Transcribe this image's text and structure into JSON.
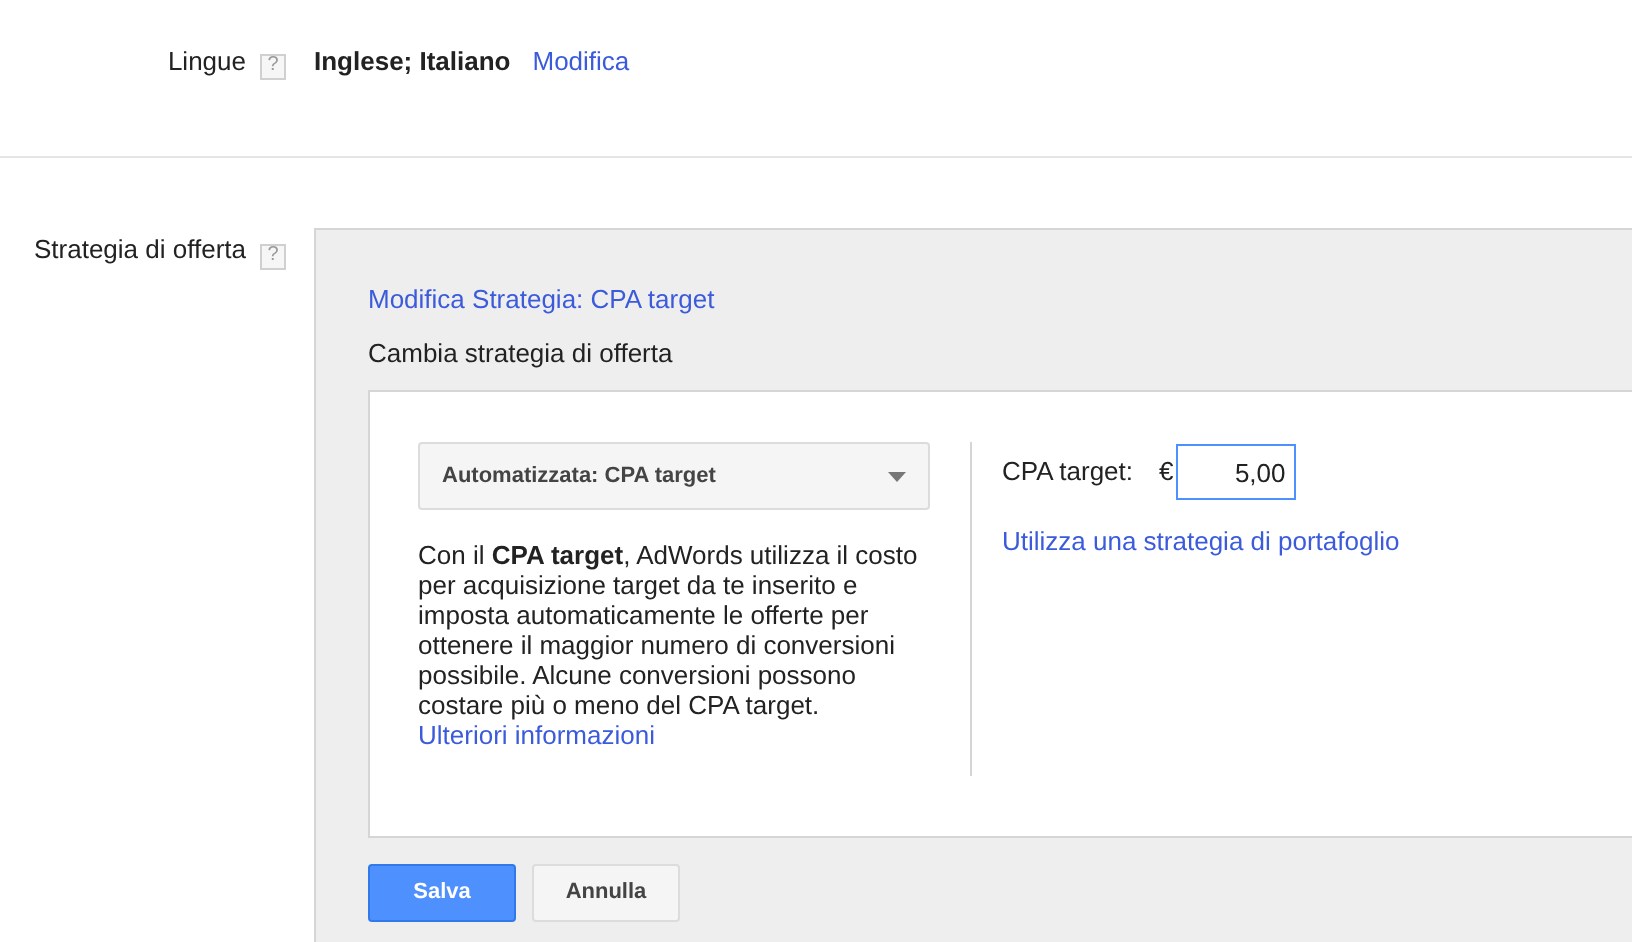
{
  "languages": {
    "label": "Lingue",
    "help": "?",
    "value": "Inglese; Italiano",
    "edit_link": "Modifica"
  },
  "bid_strategy": {
    "label": "Strategia di offerta",
    "help": "?",
    "edit_link": "Modifica Strategia: CPA target",
    "subtitle": "Cambia strategia di offerta",
    "dropdown": {
      "value": "Automatizzata: CPA target"
    },
    "description": "Con il **CPA target**, AdWords utilizza il costo per acquisizione target da te inserito e imposta automaticamente le offerte per ottenere il maggior numero di conversioni possibile. Alcune conversioni possono costare più o meno del CPA target.",
    "more_link": "Ulteriori informazioni",
    "cpa": {
      "label": "CPA target:",
      "currency": "€",
      "value": "5,00"
    },
    "portfolio_link": "Utilizza una strategia di portafoglio",
    "buttons": [
      {
        "label": "Salva",
        "kind": "primary"
      },
      {
        "label": "Annulla",
        "kind": "secondary"
      }
    ]
  }
}
